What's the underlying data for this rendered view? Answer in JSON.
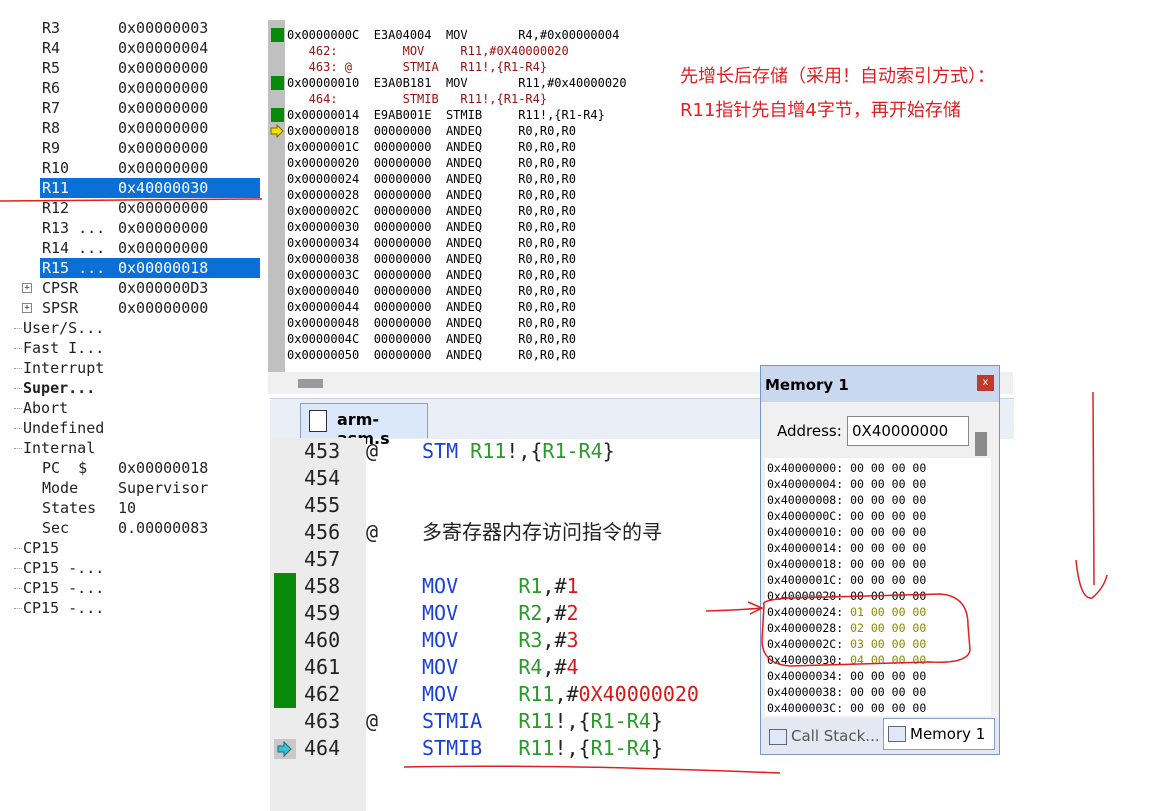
{
  "registers": {
    "rows": [
      {
        "name": "R3",
        "value": "0x00000003",
        "indent": "r"
      },
      {
        "name": "R4",
        "value": "0x00000004",
        "indent": "r"
      },
      {
        "name": "R5",
        "value": "0x00000000",
        "indent": "r"
      },
      {
        "name": "R6",
        "value": "0x00000000",
        "indent": "r"
      },
      {
        "name": "R7",
        "value": "0x00000000",
        "indent": "r"
      },
      {
        "name": "R8",
        "value": "0x00000000",
        "indent": "r"
      },
      {
        "name": "R9",
        "value": "0x00000000",
        "indent": "r"
      },
      {
        "name": "R10",
        "value": "0x00000000",
        "indent": "r"
      },
      {
        "name": "R11",
        "value": "0x40000030",
        "indent": "r",
        "selected": true
      },
      {
        "name": "R12",
        "value": "0x00000000",
        "indent": "r"
      },
      {
        "name": "R13 ...",
        "value": "0x00000000",
        "indent": "r"
      },
      {
        "name": "R14 ...",
        "value": "0x00000000",
        "indent": "r"
      },
      {
        "name": "R15 ...",
        "value": "0x00000018",
        "indent": "r",
        "selected": true
      },
      {
        "name": "CPSR",
        "value": "0x000000D3",
        "indent": "r",
        "plus": true
      },
      {
        "name": "SPSR",
        "value": "0x00000000",
        "indent": "r",
        "plus": true
      },
      {
        "name": "User/S...",
        "value": "",
        "indent": "g"
      },
      {
        "name": "Fast I...",
        "value": "",
        "indent": "g"
      },
      {
        "name": "Interrupt",
        "value": "",
        "indent": "g"
      },
      {
        "name": "Super...",
        "value": "",
        "indent": "g",
        "bold": true
      },
      {
        "name": "Abort",
        "value": "",
        "indent": "g"
      },
      {
        "name": "Undefined",
        "value": "",
        "indent": "g"
      },
      {
        "name": "Internal",
        "value": "",
        "indent": "g"
      },
      {
        "name": "PC  $",
        "value": "0x00000018",
        "indent": "r"
      },
      {
        "name": "Mode",
        "value": "Supervisor",
        "indent": "r"
      },
      {
        "name": "States",
        "value": "10",
        "indent": "r"
      },
      {
        "name": "Sec",
        "value": "0.00000083",
        "indent": "r"
      },
      {
        "name": "CP15",
        "value": "",
        "indent": "g"
      },
      {
        "name": "CP15 -...",
        "value": "",
        "indent": "g"
      },
      {
        "name": "CP15 -...",
        "value": "",
        "indent": "g"
      },
      {
        "name": "CP15 -...",
        "value": "",
        "indent": "g"
      }
    ]
  },
  "disassembly": {
    "rows": [
      {
        "text": "0x0000000C  E3A04004  MOV       R4,#0x00000004",
        "type": "asm",
        "mark": "green"
      },
      {
        "text": "   462:         MOV     R11,#0X40000020",
        "type": "src"
      },
      {
        "text": "   463: @       STMIA   R11!,{R1-R4}",
        "type": "src"
      },
      {
        "text": "0x00000010  E3A0B181  MOV       R11,#0x40000020",
        "type": "asm",
        "mark": "green"
      },
      {
        "text": "   464:         STMIB   R11!,{R1-R4}",
        "type": "src"
      },
      {
        "text": "0x00000014  E9AB001E  STMIB     R11!,{R1-R4}",
        "type": "asm",
        "mark": "green"
      },
      {
        "text": "0x00000018  00000000  ANDEQ     R0,R0,R0",
        "type": "asm",
        "mark": "arrow"
      },
      {
        "text": "0x0000001C  00000000  ANDEQ     R0,R0,R0",
        "type": "asm"
      },
      {
        "text": "0x00000020  00000000  ANDEQ     R0,R0,R0",
        "type": "asm"
      },
      {
        "text": "0x00000024  00000000  ANDEQ     R0,R0,R0",
        "type": "asm"
      },
      {
        "text": "0x00000028  00000000  ANDEQ     R0,R0,R0",
        "type": "asm"
      },
      {
        "text": "0x0000002C  00000000  ANDEQ     R0,R0,R0",
        "type": "asm"
      },
      {
        "text": "0x00000030  00000000  ANDEQ     R0,R0,R0",
        "type": "asm"
      },
      {
        "text": "0x00000034  00000000  ANDEQ     R0,R0,R0",
        "type": "asm"
      },
      {
        "text": "0x00000038  00000000  ANDEQ     R0,R0,R0",
        "type": "asm"
      },
      {
        "text": "0x0000003C  00000000  ANDEQ     R0,R0,R0",
        "type": "asm"
      },
      {
        "text": "0x00000040  00000000  ANDEQ     R0,R0,R0",
        "type": "asm"
      },
      {
        "text": "0x00000044  00000000  ANDEQ     R0,R0,R0",
        "type": "asm"
      },
      {
        "text": "0x00000048  00000000  ANDEQ     R0,R0,R0",
        "type": "asm"
      },
      {
        "text": "0x0000004C  00000000  ANDEQ     R0,R0,R0",
        "type": "asm"
      },
      {
        "text": "0x00000050  00000000  ANDEQ     R0,R0,R0",
        "type": "asm"
      }
    ]
  },
  "annotation": {
    "text": "先增长后存储（采用！自动索引方式）： R11指针先自增4字节，再开始存储"
  },
  "editor": {
    "tab_label": "arm-asm.s",
    "lines": [
      {
        "num": "453",
        "marker": "@",
        "parts": [
          {
            "t": "STM",
            "c": "blue"
          },
          {
            "t": " R11",
            "c": "green"
          },
          {
            "t": "!,{",
            "c": "dark"
          },
          {
            "t": "R1-R4",
            "c": "green"
          },
          {
            "t": "}",
            "c": "dark"
          }
        ],
        "gutter": ""
      },
      {
        "num": "454",
        "marker": "",
        "parts": [],
        "gutter": ""
      },
      {
        "num": "455",
        "marker": "",
        "parts": [],
        "gutter": ""
      },
      {
        "num": "456",
        "marker": "@",
        "parts": [
          {
            "t": "多寄存器内存访问指令的寻",
            "c": "dark"
          }
        ],
        "gutter": ""
      },
      {
        "num": "457",
        "marker": "",
        "parts": [],
        "gutter": ""
      },
      {
        "num": "458",
        "marker": "",
        "parts": [
          {
            "t": "MOV",
            "c": "blue"
          },
          {
            "t": "     R1",
            "c": "green"
          },
          {
            "t": ",#",
            "c": "dark"
          },
          {
            "t": "1",
            "c": "red"
          }
        ],
        "gutter": "green"
      },
      {
        "num": "459",
        "marker": "",
        "parts": [
          {
            "t": "MOV",
            "c": "blue"
          },
          {
            "t": "     R2",
            "c": "green"
          },
          {
            "t": ",#",
            "c": "dark"
          },
          {
            "t": "2",
            "c": "red"
          }
        ],
        "gutter": "green"
      },
      {
        "num": "460",
        "marker": "",
        "parts": [
          {
            "t": "MOV",
            "c": "blue"
          },
          {
            "t": "     R3",
            "c": "green"
          },
          {
            "t": ",#",
            "c": "dark"
          },
          {
            "t": "3",
            "c": "red"
          }
        ],
        "gutter": "green"
      },
      {
        "num": "461",
        "marker": "",
        "parts": [
          {
            "t": "MOV",
            "c": "blue"
          },
          {
            "t": "     R4",
            "c": "green"
          },
          {
            "t": ",#",
            "c": "dark"
          },
          {
            "t": "4",
            "c": "red"
          }
        ],
        "gutter": "green"
      },
      {
        "num": "462",
        "marker": "",
        "parts": [
          {
            "t": "MOV",
            "c": "blue"
          },
          {
            "t": "     R11",
            "c": "green"
          },
          {
            "t": ",#",
            "c": "dark"
          },
          {
            "t": "0X40000020",
            "c": "red"
          }
        ],
        "gutter": "green"
      },
      {
        "num": "463",
        "marker": "@",
        "parts": [
          {
            "t": "STMIA",
            "c": "blue"
          },
          {
            "t": "   R11",
            "c": "green"
          },
          {
            "t": "!,{",
            "c": "dark"
          },
          {
            "t": "R1-R4",
            "c": "green"
          },
          {
            "t": "}",
            "c": "dark"
          }
        ],
        "gutter": ""
      },
      {
        "num": "464",
        "marker": "",
        "parts": [
          {
            "t": "STMIB",
            "c": "blue"
          },
          {
            "t": "   R11",
            "c": "green"
          },
          {
            "t": "!,{",
            "c": "dark"
          },
          {
            "t": "R1-R4",
            "c": "green"
          },
          {
            "t": "}",
            "c": "dark"
          }
        ],
        "gutter": "arrow"
      }
    ]
  },
  "memory": {
    "title": "Memory 1",
    "close_label": "x",
    "address_label": "Address:",
    "address_value": "0X40000000",
    "rows": [
      {
        "addr": "0x40000000:",
        "vals": "00 00 00 00",
        "changed": false
      },
      {
        "addr": "0x40000004:",
        "vals": "00 00 00 00",
        "changed": false
      },
      {
        "addr": "0x40000008:",
        "vals": "00 00 00 00",
        "changed": false
      },
      {
        "addr": "0x4000000C:",
        "vals": "00 00 00 00",
        "changed": false
      },
      {
        "addr": "0x40000010:",
        "vals": "00 00 00 00",
        "changed": false
      },
      {
        "addr": "0x40000014:",
        "vals": "00 00 00 00",
        "changed": false
      },
      {
        "addr": "0x40000018:",
        "vals": "00 00 00 00",
        "changed": false
      },
      {
        "addr": "0x4000001C:",
        "vals": "00 00 00 00",
        "changed": false
      },
      {
        "addr": "0x40000020:",
        "vals": "00 00 00 00",
        "changed": false
      },
      {
        "addr": "0x40000024:",
        "vals": "01 00 00 00",
        "changed": true
      },
      {
        "addr": "0x40000028:",
        "vals": "02 00 00 00",
        "changed": true
      },
      {
        "addr": "0x4000002C:",
        "vals": "03 00 00 00",
        "changed": true
      },
      {
        "addr": "0x40000030:",
        "vals": "04 00 00 00",
        "changed": true
      },
      {
        "addr": "0x40000034:",
        "vals": "00 00 00 00",
        "changed": false
      },
      {
        "addr": "0x40000038:",
        "vals": "00 00 00 00",
        "changed": false
      },
      {
        "addr": "0x4000003C:",
        "vals": "00 00 00 00",
        "changed": false
      }
    ],
    "tabs": {
      "call_stack": "Call Stack...",
      "memory": "Memory 1"
    }
  },
  "colors": {
    "selection": "#0a6fd6",
    "exec_mark": "#0a8a0a",
    "annotation": "#e02020",
    "changed_value": "#8a8a00"
  }
}
